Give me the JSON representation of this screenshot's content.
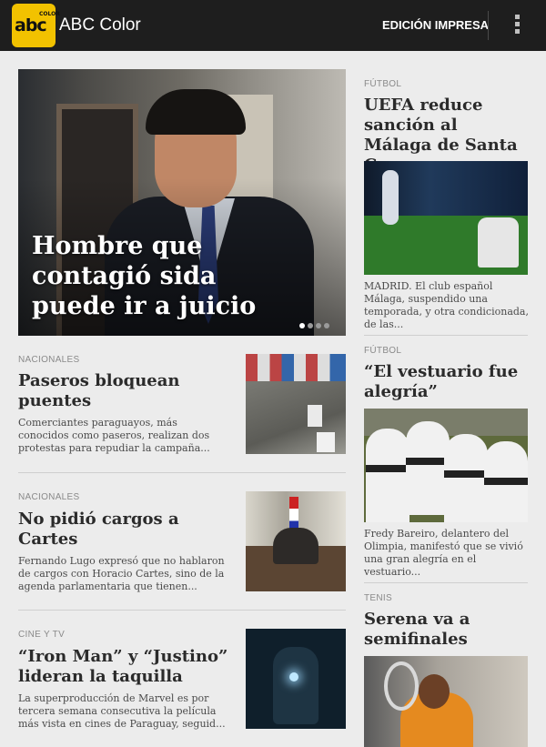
{
  "app": {
    "logo_text": "abc",
    "logo_small": "COLOR",
    "title": "ABC Color",
    "action_label": "EDICIÓN IMPRESA",
    "overflow_icon": "overflow-menu-icon"
  },
  "hero": {
    "title": "Hombre que contagió sida puede ir a juicio",
    "slide_index": 1,
    "slide_count": 4
  },
  "left_articles": [
    {
      "category": "NACIONALES",
      "title": "Paseros bloquean puentes",
      "summary": "Comerciantes paraguayos, más conocidos como paseros, realizan dos protestas para repudiar la campaña..."
    },
    {
      "category": "NACIONALES",
      "title": "No pidió cargos a Cartes",
      "summary": "Fernando Lugo expresó que no hablaron de cargos con Horacio Cartes, sino de la agenda parlamentaria que tienen..."
    },
    {
      "category": "CINE Y TV",
      "title": "“Iron Man” y “Justino” lideran la taquilla",
      "summary": "La superproducción de Marvel es por tercera semana consecutiva la película más vista en cines de Paraguay, seguid..."
    }
  ],
  "right_articles": [
    {
      "category": "FÚTBOL",
      "title": "UEFA reduce sanción al Málaga de Santa Cruz",
      "summary": "MADRID. El club español Málaga, suspendido una temporada, y otra condicionada, de las..."
    },
    {
      "category": "FÚTBOL",
      "title": "“El vestuario fue alegría”",
      "summary": "Fredy Bareiro, delantero del Olimpia, manifestó que se vivió una gran alegría en el vestuario..."
    },
    {
      "category": "TENIS",
      "title": "Serena va a semifinales"
    }
  ],
  "colors": {
    "topbar": "#1e1e1e",
    "logo": "#f2c200",
    "background": "#ececec"
  }
}
